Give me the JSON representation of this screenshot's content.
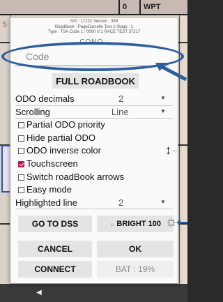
{
  "background": {
    "top_cells": [
      "0",
      "WPT"
    ],
    "left_marker": "5"
  },
  "dialog": {
    "header_lines": [
      "S/N : 17121 Version : 399",
      "RoadBook : PageCarcelle Test 1 Stage : 1",
      "Type : TSA Code 1 : 0000 V:1 RACE TEST 37217"
    ],
    "partial_label": "CONO :",
    "code": {
      "placeholder": "Code",
      "value": ""
    },
    "full_roadbook_label": "FULL ROADBOOK",
    "settings": {
      "odo_decimals": {
        "label": "ODO decimals",
        "value": "2"
      },
      "scrolling": {
        "label": "Scrolling",
        "value": "Line"
      },
      "checkboxes": [
        {
          "label": "Partial ODO priority",
          "checked": false
        },
        {
          "label": "Hide partial ODO",
          "checked": false
        },
        {
          "label": "ODO inverse color",
          "checked": false
        },
        {
          "label": "Touchscreen",
          "checked": true
        },
        {
          "label": "Switch roadBook arrows",
          "checked": false
        },
        {
          "label": "Easy mode",
          "checked": false
        }
      ],
      "highlighted_line": {
        "label": "Highlighted line",
        "value": "2"
      }
    },
    "buttons": {
      "go_to_dss": "GO TO DSS",
      "bright": "BRIGHT 100",
      "cancel": "CANCEL",
      "ok": "OK",
      "connect": "CONNECT"
    },
    "battery": "BAT : 19%"
  },
  "colors": {
    "annotation": "#2d5fa0",
    "checkbox_on": "#c2185b"
  }
}
